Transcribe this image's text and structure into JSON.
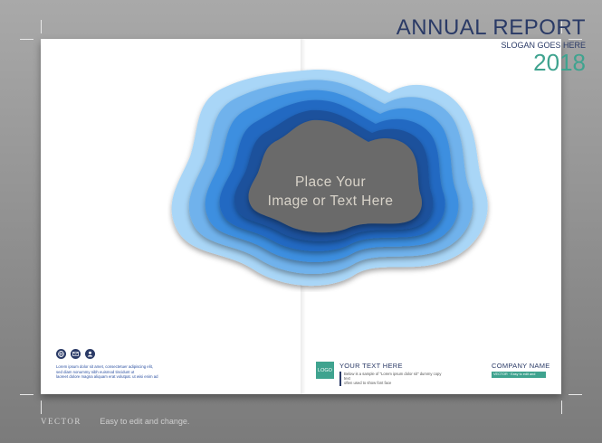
{
  "title": "ANNUAL REPORT",
  "slogan": "SLOGAN GOES HERE",
  "year": "2018",
  "placeholder": {
    "line1": "Place Your",
    "line2": "Image or Text Here"
  },
  "contact_icons": [
    "globe-icon",
    "mail-icon",
    "user-icon"
  ],
  "left_text": [
    "Lorem ipsum dolor sit amet, consectetuer adipiscing elit,",
    "sed diam nonummy nibh euismod tincidunt ut",
    "laoreet dolore magna aliquam erat volutpat. ut wisi enim ad"
  ],
  "logo": "LOGO",
  "your_text": {
    "heading": "YOUR TEXT HERE",
    "body": [
      "Below is a sample of \"Lorem ipsum dolor sit\" dummy copy text",
      "often used to show font face"
    ]
  },
  "company": {
    "name": "COMPANY NAME",
    "bar_text": "VECTOR · Easy to edit and change"
  },
  "footer": {
    "vector": "VECTOR",
    "caption": "Easy to edit and change."
  },
  "colors": {
    "navy": "#2a3a66",
    "teal": "#3fa38f",
    "blue_light": "#8ec3ef",
    "blue_mid": "#2f7fd2",
    "blue_dark": "#1d58a8",
    "center_gray": "#6a6a6a"
  }
}
